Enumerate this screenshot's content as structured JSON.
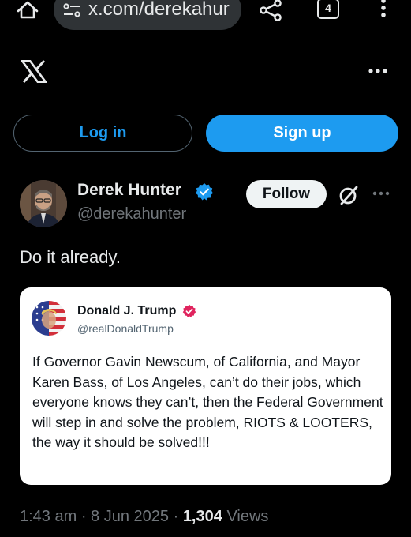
{
  "browser": {
    "url_text": "x.com/derekahur",
    "tab_count": "4"
  },
  "auth": {
    "login_label": "Log in",
    "signup_label": "Sign up"
  },
  "post": {
    "author_name": "Derek Hunter",
    "author_handle": "@derekahunter",
    "follow_label": "Follow",
    "text": "Do it already.",
    "time": "1:43 am",
    "date": "8 Jun 2025",
    "views_count": "1,304",
    "views_label": "Views"
  },
  "quoted": {
    "author_name": "Donald J. Trump",
    "author_handle": "@realDonaldTrump",
    "body": "If Governor Gavin Newscum, of California, and Mayor Karen Bass, of Los Angeles, can’t do their jobs, which everyone knows they can’t, then the Federal Government will step in and solve the problem, RIOTS & LOOTERS, the way it should be solved!!!"
  },
  "colors": {
    "accent": "#1d9bf0",
    "verified_personal": "#1d9bf0",
    "verified_quoted": "#e0245e",
    "background": "#000000"
  },
  "icons": [
    "home-icon",
    "tune-icon",
    "share-icon",
    "tabs-icon",
    "menu-icon",
    "x-logo",
    "more-icon",
    "verified-icon",
    "grok-icon"
  ]
}
